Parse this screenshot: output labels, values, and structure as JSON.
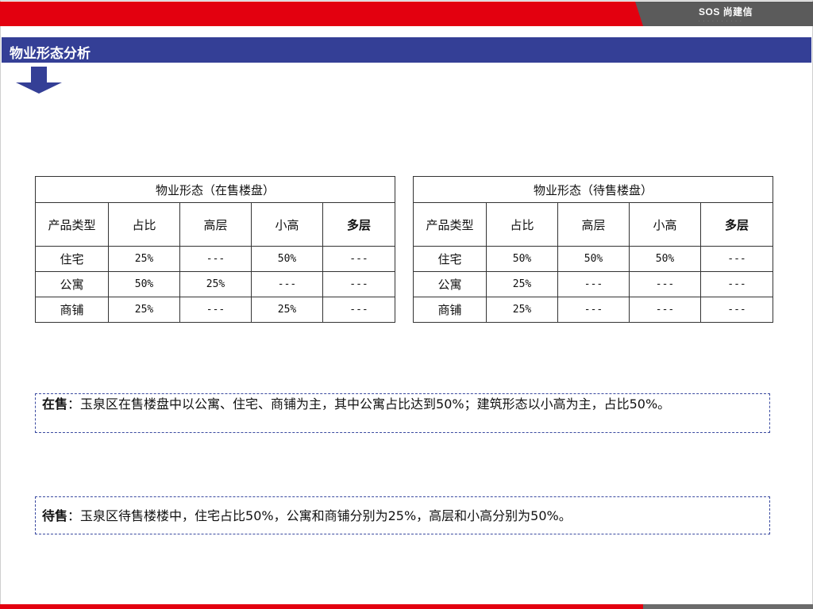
{
  "header": {
    "logo_text": "SOS 尚建信",
    "logo_sub": "· · · · · · · · · ·"
  },
  "title": "物业形态分析",
  "colors": {
    "accent_red": "#e3000f",
    "title_blue": "#343f96",
    "dark_gray": "#5b5b5b"
  },
  "icons": {
    "arrow": "down-arrow-icon"
  },
  "tables": [
    {
      "title": "物业形态（在售楼盘）",
      "headers": [
        "产品类型",
        "占比",
        "高层",
        "小高",
        "多层"
      ],
      "rows": [
        [
          "住宅",
          "25%",
          "---",
          "50%",
          "---"
        ],
        [
          "公寓",
          "50%",
          "25%",
          "---",
          "---"
        ],
        [
          "商铺",
          "25%",
          "---",
          "25%",
          "---"
        ]
      ]
    },
    {
      "title": "物业形态（待售楼盘）",
      "headers": [
        "产品类型",
        "占比",
        "高层",
        "小高",
        "多层"
      ],
      "rows": [
        [
          "住宅",
          "50%",
          "50%",
          "50%",
          "---"
        ],
        [
          "公寓",
          "25%",
          "---",
          "---",
          "---"
        ],
        [
          "商铺",
          "25%",
          "---",
          "---",
          "---"
        ]
      ]
    }
  ],
  "notes": [
    {
      "label": "在售",
      "text": "：玉泉区在售楼盘中以公寓、住宅、商铺为主，其中公寓占比达到50%；建筑形态以小高为主，占比50%。"
    },
    {
      "label": "待售",
      "text": "：玉泉区待售楼楼中，住宅占比50%，公寓和商铺分别为25%，高层和小高分别为50%。"
    }
  ]
}
